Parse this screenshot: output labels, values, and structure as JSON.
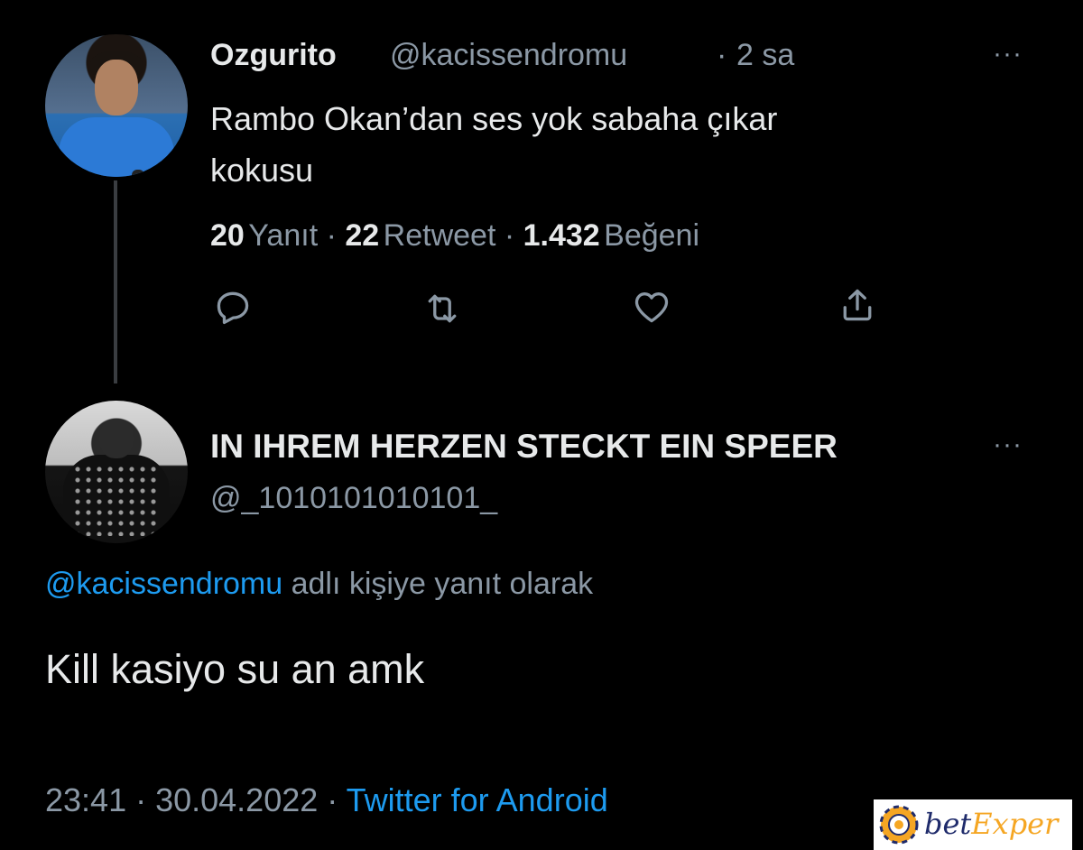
{
  "parent_tweet": {
    "display_name": "Ozgurito",
    "handle": "@kacissendromu",
    "separator": "·",
    "time": "2 sa",
    "more_label": "···",
    "text_line1": "Rambo Okan’dan ses yok sabaha çıkar",
    "text_line2": "kokusu",
    "stats": {
      "replies_count": "20",
      "replies_label": "Yanıt",
      "retweets_count": "22",
      "retweets_label": "Retweet",
      "likes_count": "1.432",
      "likes_label": "Beğeni",
      "separator": " · "
    },
    "actions": [
      "reply-icon",
      "retweet-icon",
      "like-icon",
      "share-icon"
    ]
  },
  "reply_tweet": {
    "display_name": "IN IHREM HERZEN STECKT EIN SPEER",
    "handle": "@_1010101010101_",
    "more_label": "···",
    "reply_to_mention": "@kacissendromu",
    "reply_to_suffix": " adlı kişiye yanıt olarak",
    "text": "Kill kasiyo su an amk",
    "timestamp": "23:41 · 30.04.2022 · ",
    "source": "Twitter for Android"
  },
  "watermark": {
    "text_prefix": "bet",
    "text_accent": "Exper"
  },
  "colors": {
    "background": "#000000",
    "primary_text": "#e7e9ea",
    "secondary_text": "#8b98a5",
    "link": "#1d9bf0"
  }
}
